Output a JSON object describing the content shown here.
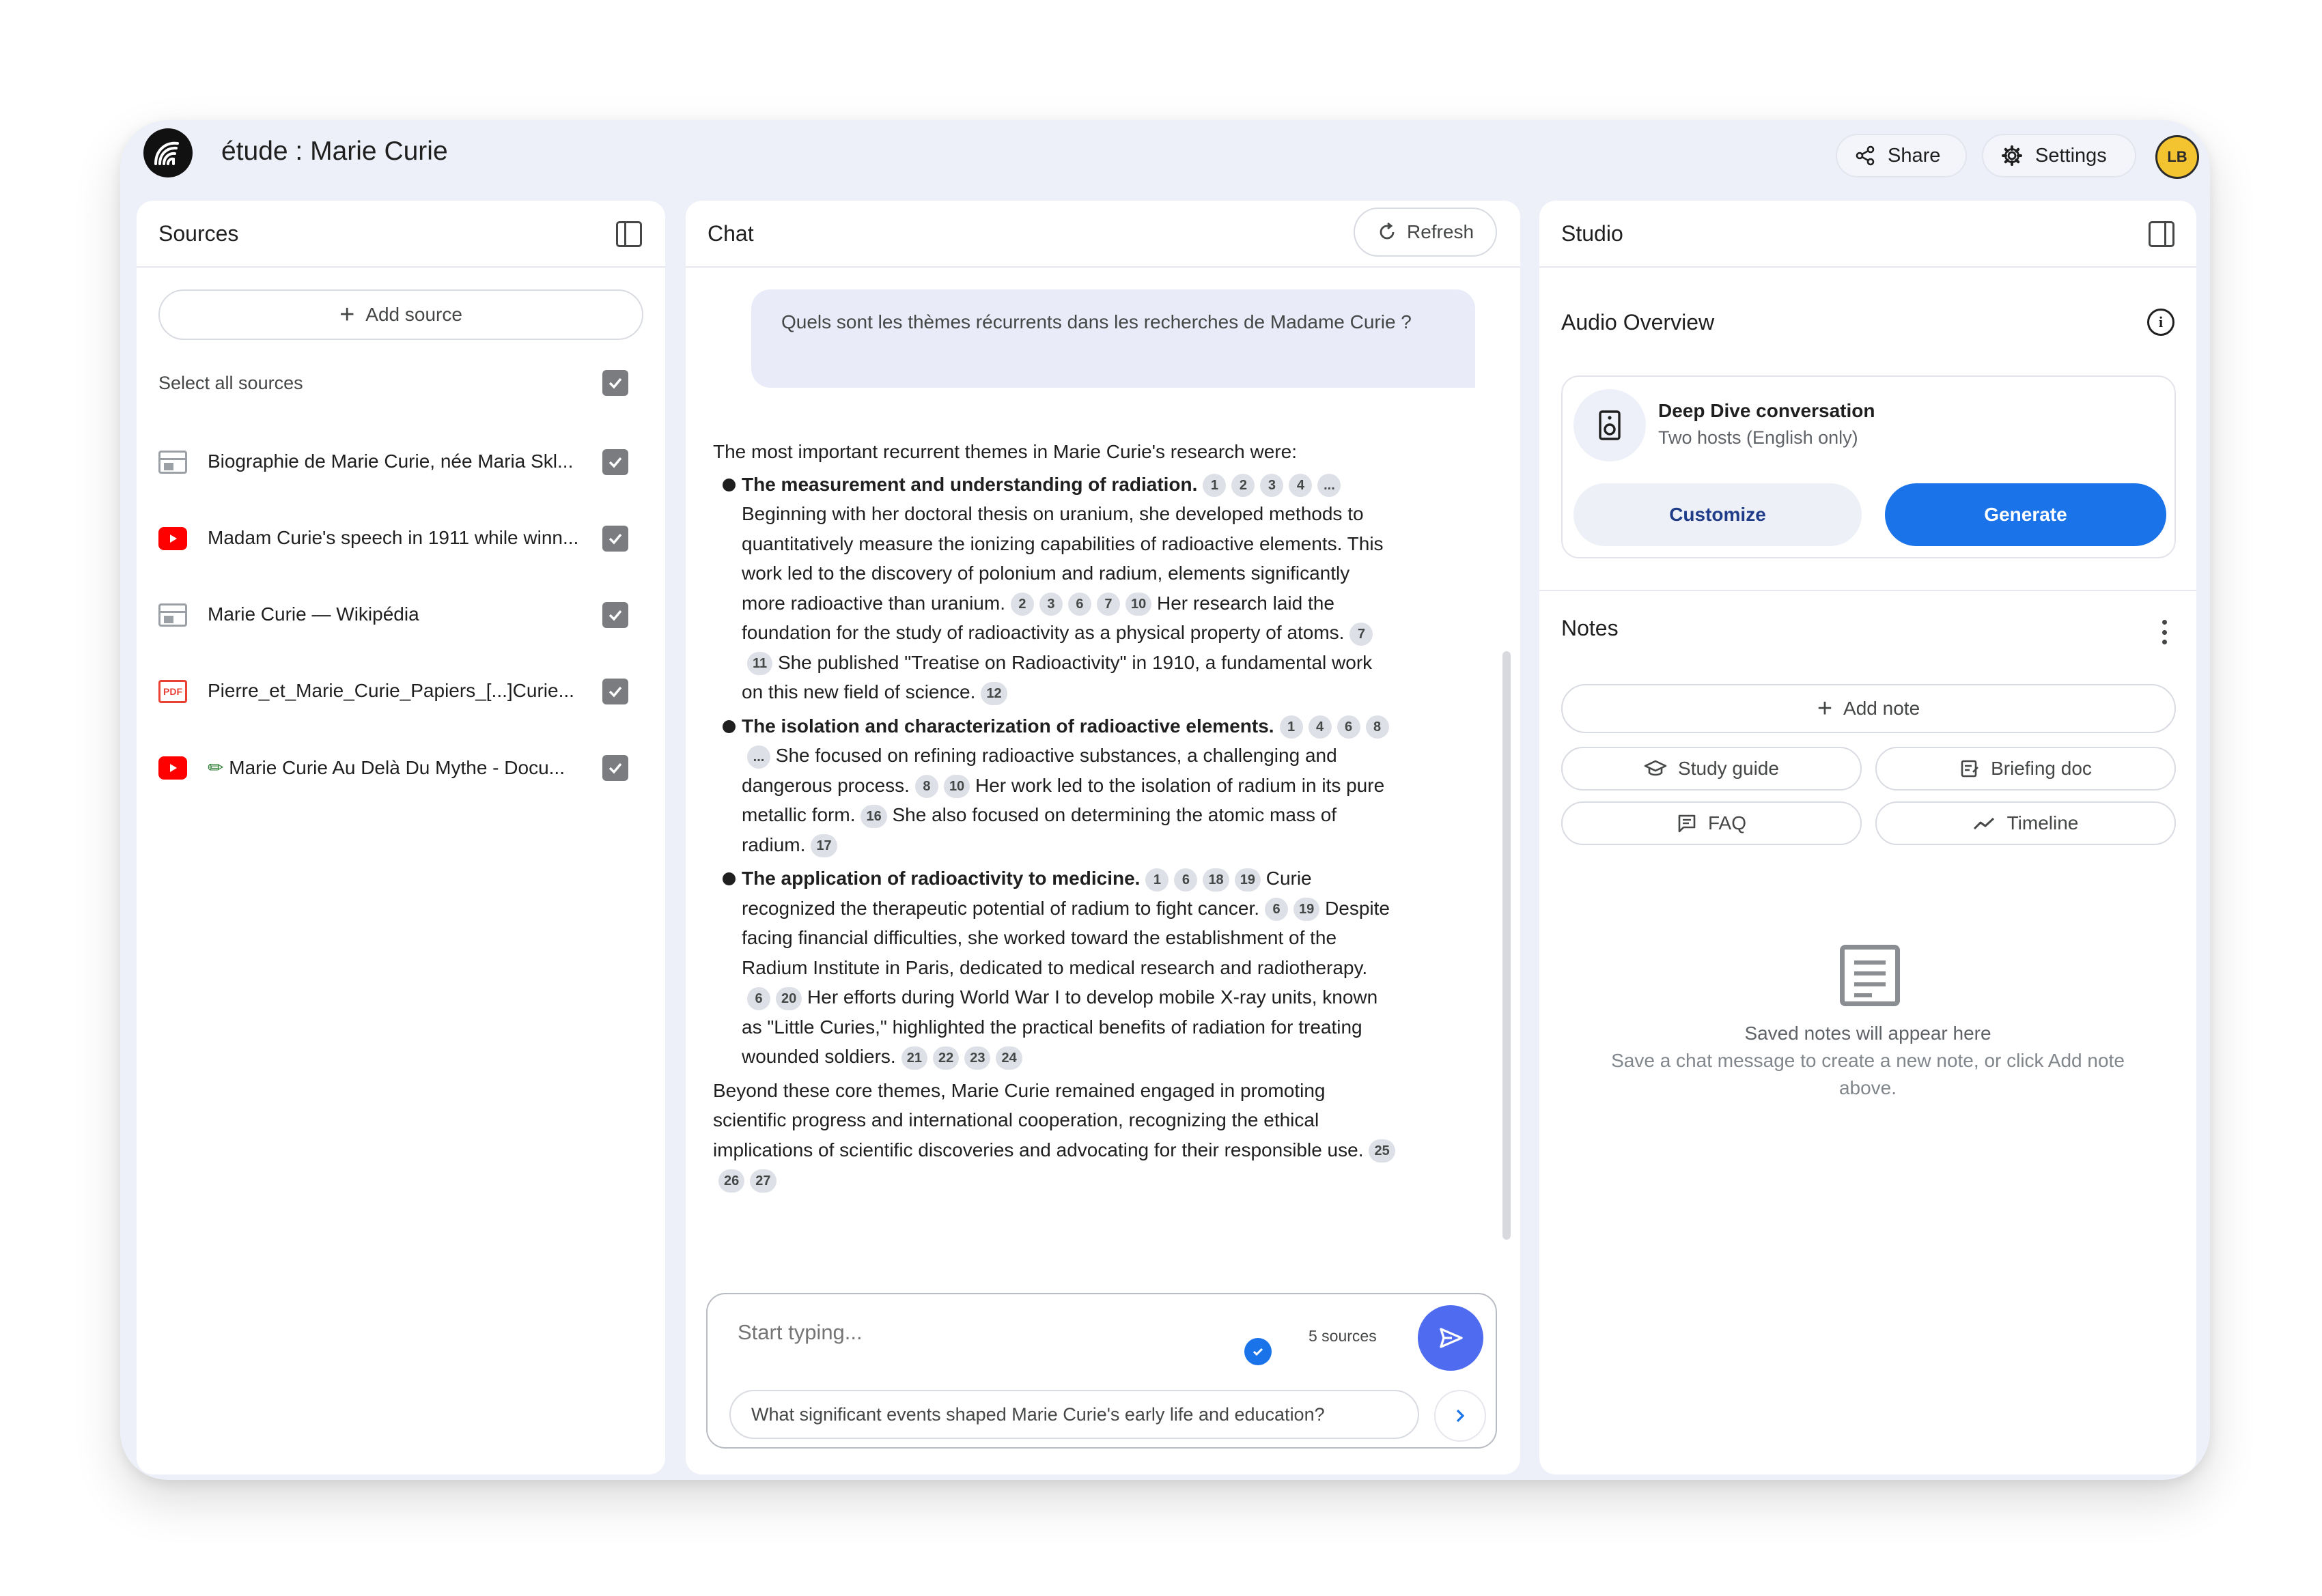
{
  "app": {
    "title": "étude : Marie Curie",
    "avatar_text": "LB"
  },
  "header": {
    "share_label": "Share",
    "settings_label": "Settings"
  },
  "sources": {
    "title": "Sources",
    "add_label": "Add source",
    "select_all_label": "Select all sources",
    "items": [
      {
        "label": "Biographie de Marie Curie, née Maria Skl...",
        "type": "web",
        "checked": true
      },
      {
        "label": "Madam Curie's speech in 1911 while winn...",
        "type": "youtube",
        "checked": true
      },
      {
        "label": "Marie Curie — Wikipédia",
        "type": "web",
        "checked": true
      },
      {
        "label": "Pierre_et_Marie_Curie_Papiers_[...]Curie...",
        "type": "pdf",
        "checked": true
      },
      {
        "label": "Marie Curie Au Delà Du Mythe - Docu...",
        "type": "youtube",
        "checked": true
      }
    ]
  },
  "chat": {
    "title": "Chat",
    "refresh_label": "Refresh",
    "user_message": "Quels sont les thèmes récurrents dans les recherches de Madame Curie ?",
    "answer": {
      "intro": "The most important recurrent themes in Marie Curie's research were:",
      "bullets": [
        {
          "heading": "The measurement and understanding of radiation.",
          "heading_cites": [
            "1",
            "2",
            "3",
            "4",
            "..."
          ],
          "sentences": [
            {
              "text": "Beginning with her doctoral thesis on uranium, she developed methods to quantitatively measure the ionizing capabilities of radioactive elements. This work led to the discovery of polonium and radium, elements significantly more radioactive than uranium.",
              "cites": [
                "2",
                "3",
                "6",
                "7",
                "10"
              ]
            },
            {
              "text": "Her research laid the foundation for the study of radioactivity as a physical property of atoms.",
              "cites": [
                "7",
                "11"
              ]
            },
            {
              "text": "She published \"Treatise on Radioactivity\" in 1910, a fundamental work on this new field of science.",
              "cites": [
                "12"
              ]
            }
          ]
        },
        {
          "heading": "The isolation and characterization of radioactive elements.",
          "heading_cites": [
            "1",
            "4",
            "6",
            "8",
            "..."
          ],
          "sentences": [
            {
              "text": "She focused on refining radioactive substances, a challenging and dangerous process.",
              "cites": [
                "8",
                "10"
              ]
            },
            {
              "text": "Her work led to the isolation of radium in its pure metallic form.",
              "cites": [
                "16"
              ]
            },
            {
              "text": "She also focused on determining the atomic mass of radium.",
              "cites": [
                "17"
              ]
            }
          ]
        },
        {
          "heading": "The application of radioactivity to medicine.",
          "heading_cites": [
            "1",
            "6",
            "18",
            "19"
          ],
          "sentences": [
            {
              "text": "Curie recognized the therapeutic potential of radium to fight cancer.",
              "cites": [
                "6",
                "19"
              ]
            },
            {
              "text": "Despite facing financial difficulties, she worked toward the establishment of the Radium Institute in Paris, dedicated to medical research and radiotherapy.",
              "cites": [
                "6",
                "20"
              ]
            },
            {
              "text": "Her efforts during World War I to develop mobile X-ray units, known as \"Little Curies,\" highlighted the practical benefits of radiation for treating wounded soldiers.",
              "cites": [
                "21",
                "22",
                "23",
                "24"
              ]
            }
          ]
        }
      ],
      "outro": "Beyond these core themes, Marie Curie remained engaged in promoting scientific progress and international cooperation, recognizing the ethical implications of scientific discoveries and advocating for their responsible use.",
      "outro_cites": [
        "25",
        "26",
        "27"
      ]
    },
    "composer": {
      "placeholder": "Start typing...",
      "sources_count": "5 sources",
      "suggestion": "What significant events shaped Marie Curie's early life and education?"
    }
  },
  "studio": {
    "title": "Studio",
    "audio": {
      "title": "Audio Overview",
      "card_title": "Deep Dive conversation",
      "card_subtitle": "Two hosts (English only)",
      "customize_label": "Customize",
      "generate_label": "Generate"
    },
    "notes": {
      "title": "Notes",
      "add_label": "Add note",
      "chips": [
        {
          "label": "Study guide",
          "icon": "graduation-cap-icon"
        },
        {
          "label": "Briefing doc",
          "icon": "doc-note-icon"
        },
        {
          "label": "FAQ",
          "icon": "faq-icon"
        },
        {
          "label": "Timeline",
          "icon": "timeline-icon"
        }
      ],
      "empty_title": "Saved notes will appear here",
      "empty_subtitle": "Save a chat message to create a new note, or click Add note above."
    }
  },
  "colors": {
    "accent": "#1a73e8",
    "send": "#4f6bf0",
    "window_bg": "#eef0f9",
    "youtube": "#ff0000",
    "pdf": "#e94235"
  }
}
